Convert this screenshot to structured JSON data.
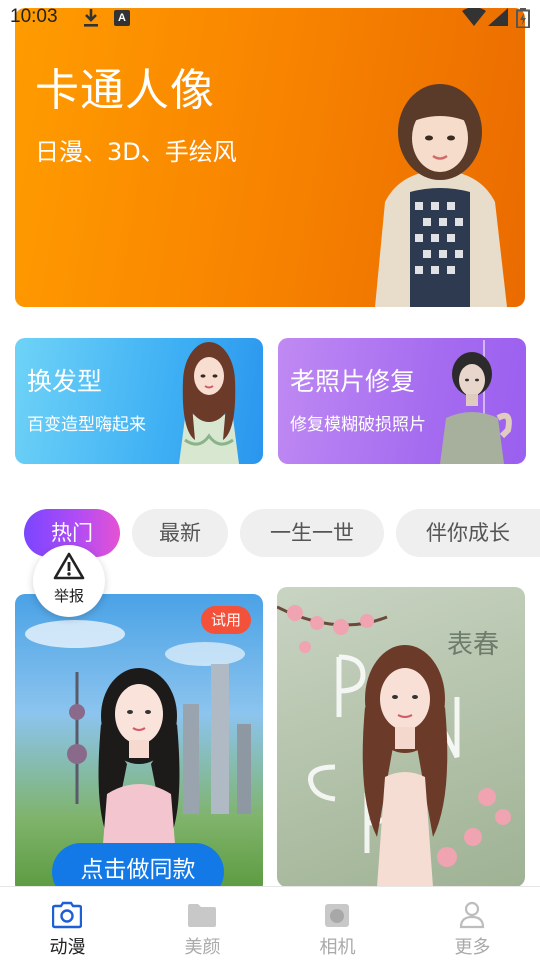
{
  "status_bar": {
    "time": "10:03",
    "icons": [
      "download-icon",
      "a-badge-icon",
      "wifi-icon",
      "signal-icon",
      "battery-icon"
    ],
    "a_badge": "A"
  },
  "hero": {
    "title": "卡通人像",
    "subtitle": "日漫、3D、手绘风",
    "colors": {
      "start": "#ff9c00",
      "end": "#ea6b00"
    }
  },
  "feature_cards": [
    {
      "title": "换发型",
      "desc": "百变造型嗨起来",
      "color": "#3fb0f4"
    },
    {
      "title": "老照片修复",
      "desc": "修复模糊破损照片",
      "color": "#a56cf0"
    }
  ],
  "tabs": [
    {
      "label": "热门",
      "active": true
    },
    {
      "label": "最新",
      "active": false
    },
    {
      "label": "一生一世",
      "active": false
    },
    {
      "label": "伴你成长",
      "active": false
    }
  ],
  "report": {
    "label": "举报",
    "icon": "warning-icon"
  },
  "templates": [
    {
      "badge": "试用",
      "button": "点击做同款"
    },
    {
      "art_text": "表春",
      "art_letters": "SPRING"
    }
  ],
  "bottom_nav": [
    {
      "label": "动漫",
      "icon": "camera-icon",
      "active": true
    },
    {
      "label": "美颜",
      "icon": "folder-icon",
      "active": false
    },
    {
      "label": "相机",
      "icon": "camera-body-icon",
      "active": false
    },
    {
      "label": "更多",
      "icon": "person-icon",
      "active": false
    }
  ],
  "colors": {
    "accent": "#1379e6",
    "tab_gradient_start": "#7a45ff",
    "tab_gradient_end": "#e552d3",
    "badge": "#f4513b"
  }
}
